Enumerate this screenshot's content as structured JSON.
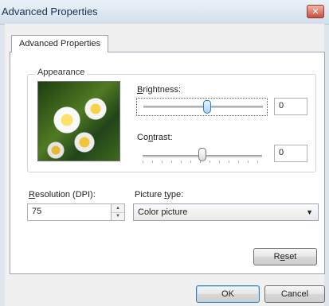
{
  "window": {
    "title": "Advanced Properties",
    "close_glyph": "✕"
  },
  "tabs": [
    {
      "label": "Advanced Properties",
      "selected": true
    }
  ],
  "appearance": {
    "group_label": "Appearance",
    "preview_icon": "daisy-flowers-photo",
    "brightness": {
      "mnemonic": "B",
      "label_rest": "rightness:",
      "value": "0"
    },
    "contrast": {
      "label_pre": "Co",
      "mnemonic": "n",
      "label_post": "trast:",
      "value": "0"
    }
  },
  "resolution": {
    "mnemonic": "R",
    "label_rest": "esolution (DPI):",
    "value": "75",
    "spin_up": "▲",
    "spin_down": "▼"
  },
  "picture_type": {
    "label_pre": "Picture ",
    "mnemonic": "t",
    "label_post": "ype:",
    "selected": "Color picture",
    "arrow": "▼"
  },
  "buttons": {
    "reset_pre": "R",
    "reset_mnemonic": "e",
    "reset_post": "set",
    "ok": "OK",
    "cancel": "Cancel"
  },
  "colors": {
    "accent": "#3c7fb1",
    "title_text": "#1d2f4f",
    "close_button": "#c9503c"
  }
}
